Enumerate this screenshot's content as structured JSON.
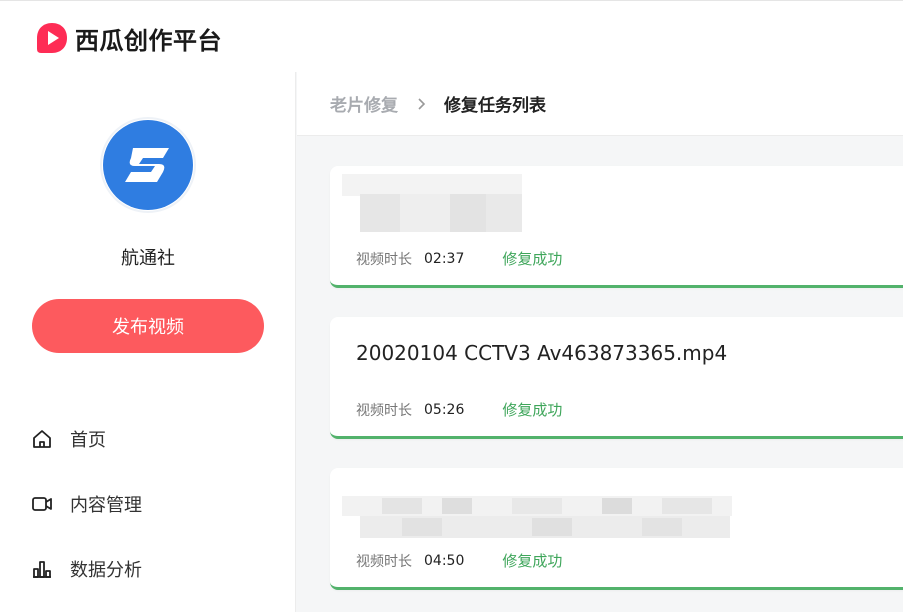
{
  "header": {
    "logo_text": "西瓜创作平台",
    "logo_color": "#fe2c55"
  },
  "sidebar": {
    "username": "航通社",
    "publish_label": "发布视频",
    "nav": [
      {
        "label": "首页",
        "icon": "home-icon"
      },
      {
        "label": "内容管理",
        "icon": "video-icon"
      },
      {
        "label": "数据分析",
        "icon": "chart-icon"
      }
    ]
  },
  "breadcrumb": {
    "parent": "老片修复",
    "current": "修复任务列表"
  },
  "tasks": [
    {
      "title": "",
      "title_blurred": true,
      "duration_label": "视频时长",
      "duration": "02:37",
      "status": "修复成功"
    },
    {
      "title": "20020104 CCTV3 Av463873365.mp4",
      "title_blurred": false,
      "duration_label": "视频时长",
      "duration": "05:26",
      "status": "修复成功"
    },
    {
      "title": "",
      "title_blurred": true,
      "duration_label": "视频时长",
      "duration": "04:50",
      "status": "修复成功"
    }
  ],
  "colors": {
    "accent": "#fd5a5e",
    "success": "#3fa65b",
    "avatar_blue": "#2f7de1"
  }
}
